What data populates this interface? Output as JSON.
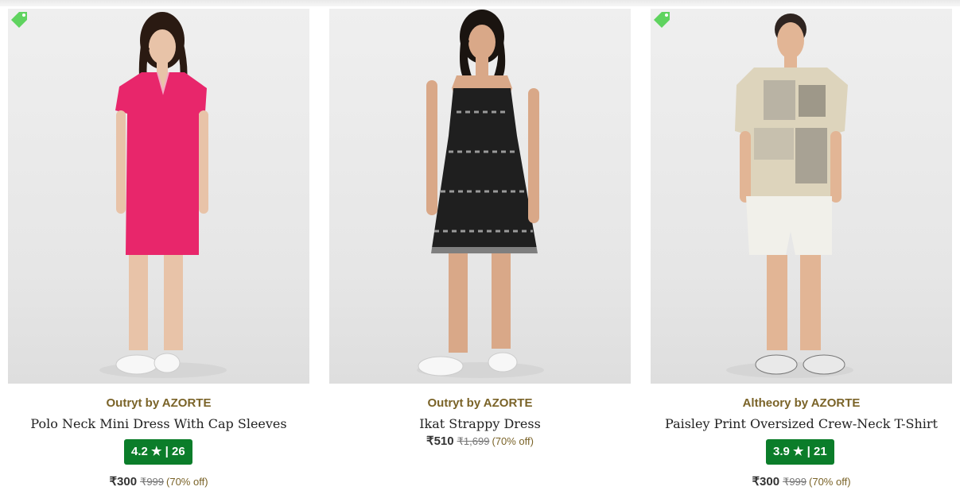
{
  "products": [
    {
      "brand": "Outryt by AZORTE",
      "name": "Polo Neck Mini Dress With Cap Sleeves",
      "rating": "4.2",
      "star": "★",
      "reviews": "26",
      "price": "₹300",
      "mrp": "₹999",
      "discount": "(70% off)",
      "has_tag": true
    },
    {
      "brand": "Outryt by AZORTE",
      "name": "Ikat Strappy Dress",
      "price": "₹510",
      "mrp": "₹1,699",
      "discount": "(70% off)",
      "has_tag": false
    },
    {
      "brand": "Altheory by AZORTE",
      "name": "Paisley Print Oversized Crew-Neck T-Shirt",
      "rating": "3.9",
      "star": "★",
      "reviews": "21",
      "price": "₹300",
      "mrp": "₹999",
      "discount": "(70% off)",
      "has_tag": true
    }
  ],
  "colors": {
    "rating_bg": "#0b7d2a",
    "brand": "#7a6328",
    "tag": "#5fd35f"
  }
}
